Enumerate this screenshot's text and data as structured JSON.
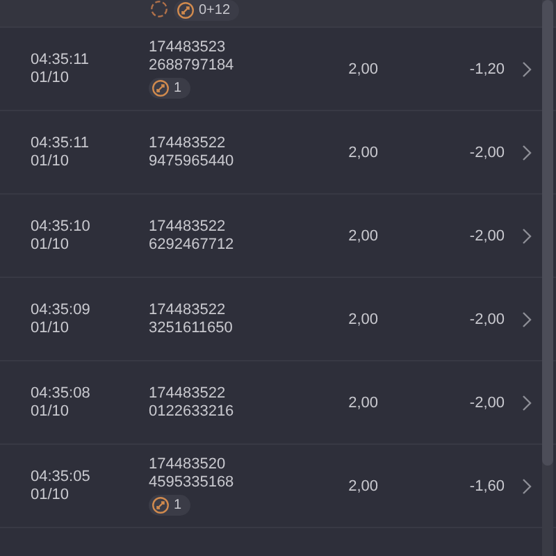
{
  "partial_row": {
    "badges": [
      {
        "kind": "pending"
      },
      {
        "kind": "count",
        "text": "0+12"
      }
    ]
  },
  "rows": [
    {
      "time": "04:35:11",
      "date": "01/10",
      "id_1": "174483523",
      "id_2": "2688797184",
      "badge": "1",
      "stake": "2,00",
      "result": "-1,20"
    },
    {
      "time": "04:35:11",
      "date": "01/10",
      "id_1": "174483522",
      "id_2": "9475965440",
      "stake": "2,00",
      "result": "-2,00"
    },
    {
      "time": "04:35:10",
      "date": "01/10",
      "id_1": "174483522",
      "id_2": "6292467712",
      "stake": "2,00",
      "result": "-2,00"
    },
    {
      "time": "04:35:09",
      "date": "01/10",
      "id_1": "174483522",
      "id_2": "3251611650",
      "stake": "2,00",
      "result": "-2,00"
    },
    {
      "time": "04:35:08",
      "date": "01/10",
      "id_1": "174483522",
      "id_2": "0122633216",
      "stake": "2,00",
      "result": "-2,00"
    },
    {
      "time": "04:35:05",
      "date": "01/10",
      "id_1": "174483520",
      "id_2": "4595335168",
      "badge": "1",
      "stake": "2,00",
      "result": "-1,60"
    }
  ]
}
